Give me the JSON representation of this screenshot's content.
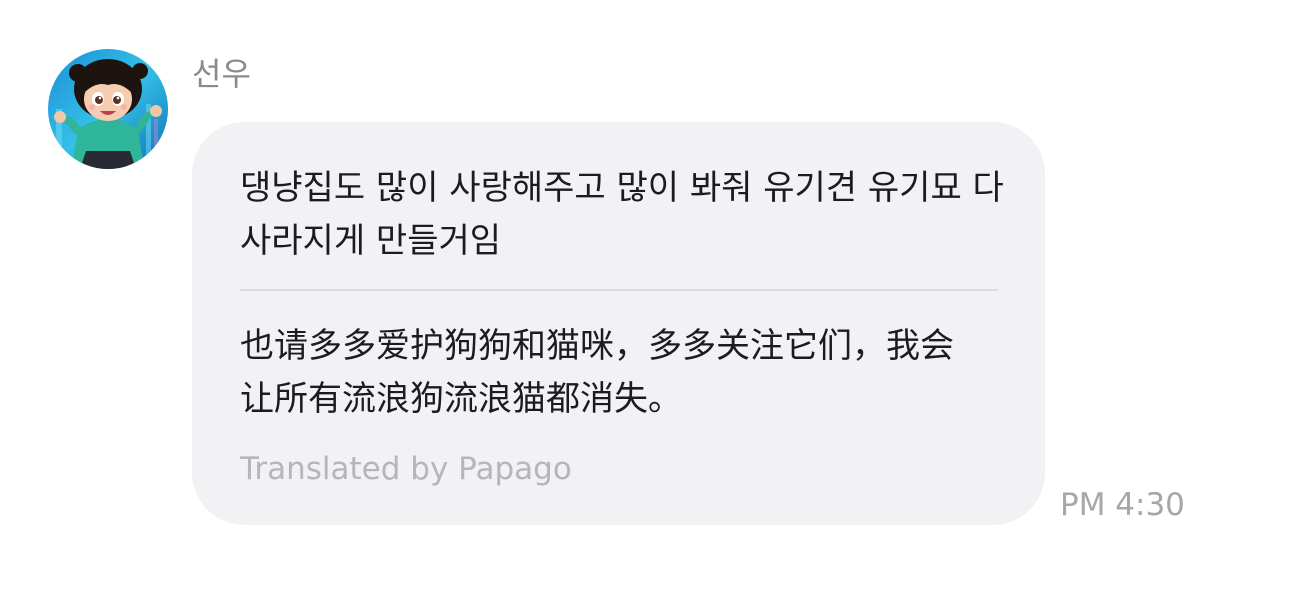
{
  "message": {
    "sender_name": "선우",
    "original_text": "댕냥집도 많이 사랑해주고 많이 봐줘 유기견 유기묘 다 사라지게 만들거임",
    "translated_text": "也请多多爱护狗狗和猫咪，多多关注它们，我会让所有流浪狗流浪猫都消失。",
    "translation_credit": "Translated by Papago",
    "time": "PM 4:30"
  }
}
